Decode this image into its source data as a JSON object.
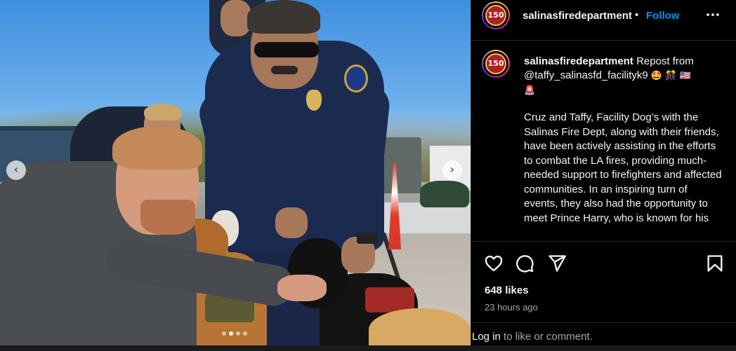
{
  "post": {
    "username": "salinasfiredepartment",
    "separator": "•",
    "follow_label": "Follow",
    "more_icon": "more-options-icon",
    "avatar_text": "150"
  },
  "caption": {
    "username": "salinasfiredepartment",
    "intro": "Repost from",
    "repost_handle": "@taffy_salinasfd_facilityk9",
    "emojis": "🤩 🎊 🇺🇸",
    "emoji_line2": "🚨",
    "body": "Cruz and Taffy, Facility Dog’s with the Salinas Fire Dept, along with their friends, have been actively assisting in the efforts to combat the LA fires, providing much-needed support to firefighters and affected communities. In an inspiring turn of events, they also had the opportunity to meet Prince Harry, who is known for his"
  },
  "actions": {
    "like_icon": "heart-icon",
    "comment_icon": "comment-icon",
    "share_icon": "share-icon",
    "save_icon": "bookmark-icon"
  },
  "stats": {
    "likes": "648 likes",
    "time": "23 hours ago"
  },
  "footer": {
    "login_link": "Log in",
    "login_rest": " to like or comment."
  },
  "carousel": {
    "prev_glyph": "‹",
    "next_glyph": "›",
    "slides": 4,
    "active_slide": 1
  }
}
